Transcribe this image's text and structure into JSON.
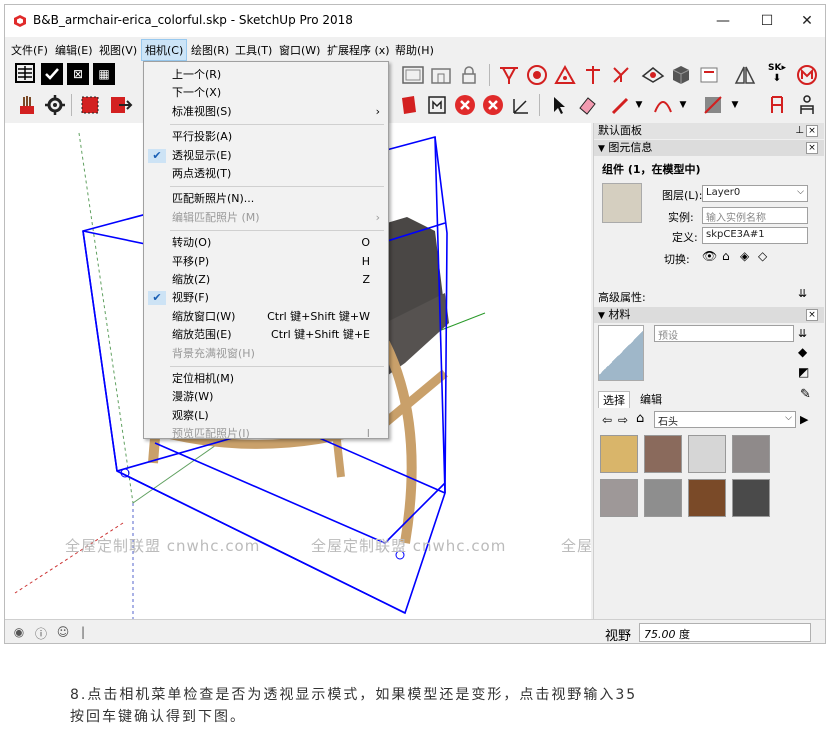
{
  "window": {
    "title": "B&B_armchair-erica_colorful.skp - SketchUp Pro 2018",
    "minimize": "—",
    "maximize": "☐",
    "close": "✕"
  },
  "menubar": [
    {
      "id": "file",
      "label": "文件(F)"
    },
    {
      "id": "edit",
      "label": "编辑(E)"
    },
    {
      "id": "view",
      "label": "视图(V)"
    },
    {
      "id": "camera",
      "label": "相机(C)"
    },
    {
      "id": "draw",
      "label": "绘图(R)"
    },
    {
      "id": "tools",
      "label": "工具(T)"
    },
    {
      "id": "window",
      "label": "窗口(W)"
    },
    {
      "id": "extensions",
      "label": "扩展程序 (x)"
    },
    {
      "id": "help",
      "label": "帮助(H)"
    }
  ],
  "camera_menu": [
    {
      "label": "上一个(R)",
      "shortcut": "",
      "checked": false,
      "disabled": false,
      "submenu": false
    },
    {
      "label": "下一个(X)",
      "shortcut": "",
      "checked": false,
      "disabled": false,
      "submenu": false
    },
    {
      "label": "标准视图(S)",
      "shortcut": "",
      "checked": false,
      "disabled": false,
      "submenu": true
    },
    {
      "sep": true
    },
    {
      "label": "平行投影(A)",
      "shortcut": "",
      "checked": false,
      "disabled": false,
      "submenu": false
    },
    {
      "label": "透视显示(E)",
      "shortcut": "",
      "checked": true,
      "disabled": false,
      "submenu": false
    },
    {
      "label": "两点透视(T)",
      "shortcut": "",
      "checked": false,
      "disabled": false,
      "submenu": false
    },
    {
      "sep": true
    },
    {
      "label": "匹配新照片(N)...",
      "shortcut": "",
      "checked": false,
      "disabled": false,
      "submenu": false
    },
    {
      "label": "编辑匹配照片 (M)",
      "shortcut": "",
      "checked": false,
      "disabled": true,
      "submenu": true
    },
    {
      "sep": true
    },
    {
      "label": "转动(O)",
      "shortcut": "O",
      "checked": false,
      "disabled": false,
      "submenu": false
    },
    {
      "label": "平移(P)",
      "shortcut": "H",
      "checked": false,
      "disabled": false,
      "submenu": false
    },
    {
      "label": "缩放(Z)",
      "shortcut": "Z",
      "checked": false,
      "disabled": false,
      "submenu": false
    },
    {
      "label": "视野(F)",
      "shortcut": "",
      "checked": true,
      "disabled": false,
      "submenu": false
    },
    {
      "label": "缩放窗口(W)",
      "shortcut": "Ctrl 键+Shift 键+W",
      "checked": false,
      "disabled": false,
      "submenu": false
    },
    {
      "label": "缩放范围(E)",
      "shortcut": "Ctrl 键+Shift 键+E",
      "checked": false,
      "disabled": false,
      "submenu": false
    },
    {
      "label": "背景充满视窗(H)",
      "shortcut": "",
      "checked": false,
      "disabled": true,
      "submenu": false
    },
    {
      "sep": true
    },
    {
      "label": "定位相机(M)",
      "shortcut": "",
      "checked": false,
      "disabled": false,
      "submenu": false
    },
    {
      "label": "漫游(W)",
      "shortcut": "",
      "checked": false,
      "disabled": false,
      "submenu": false
    },
    {
      "label": "观察(L)",
      "shortcut": "",
      "checked": false,
      "disabled": false,
      "submenu": false
    },
    {
      "label": "预览匹配照片(I)",
      "shortcut": "I",
      "checked": false,
      "disabled": true,
      "submenu": false
    }
  ],
  "tray": {
    "title": "默认面板",
    "entity_info": {
      "section": "图元信息",
      "heading": "组件 (1，在模型中)",
      "layer_label": "图层(L):",
      "layer_value": "Layer0",
      "instance_label": "实例:",
      "instance_placeholder": "输入实例名称",
      "definition_label": "定义:",
      "definition_value": "skpCE3A#1",
      "toggle_label": "切换:",
      "advanced_label": "高级属性:"
    },
    "materials": {
      "section": "材料",
      "preset_placeholder": "预设",
      "tab_select": "选择",
      "tab_edit": "编辑",
      "library": "石头",
      "swatch_colors": [
        "#d9b56a",
        "#8a6a5c",
        "#d6d6d6",
        "#8f8a8a",
        "#9e9898",
        "#8e8e8e",
        "#7a4a28",
        "#4a4a4a"
      ]
    }
  },
  "status": {
    "vcb_label": "视野",
    "vcb_value": "75.00",
    "vcb_unit": "度"
  },
  "watermark": {
    "text1": "全屋定制联盟 cnwhc.com",
    "text2": "全屋定制联盟 cnwhc.com",
    "text3": "全屋定制联盟 cnwhc.com"
  },
  "caption": {
    "line1": "8.点击相机菜单检查是否为透视显示模式，如果模型还是变形，点击视野输入35",
    "line2": "按回车键确认得到下图。"
  },
  "toolbar_icons": {
    "row1": [
      "framed-square-icon",
      "checkbox-icon",
      "text-tool-icon",
      "text-tool-icon"
    ],
    "colors": {
      "red": "#d32020",
      "blue": "#1e4fd8",
      "green": "#3aa33a",
      "selection": "#0000ff"
    }
  }
}
